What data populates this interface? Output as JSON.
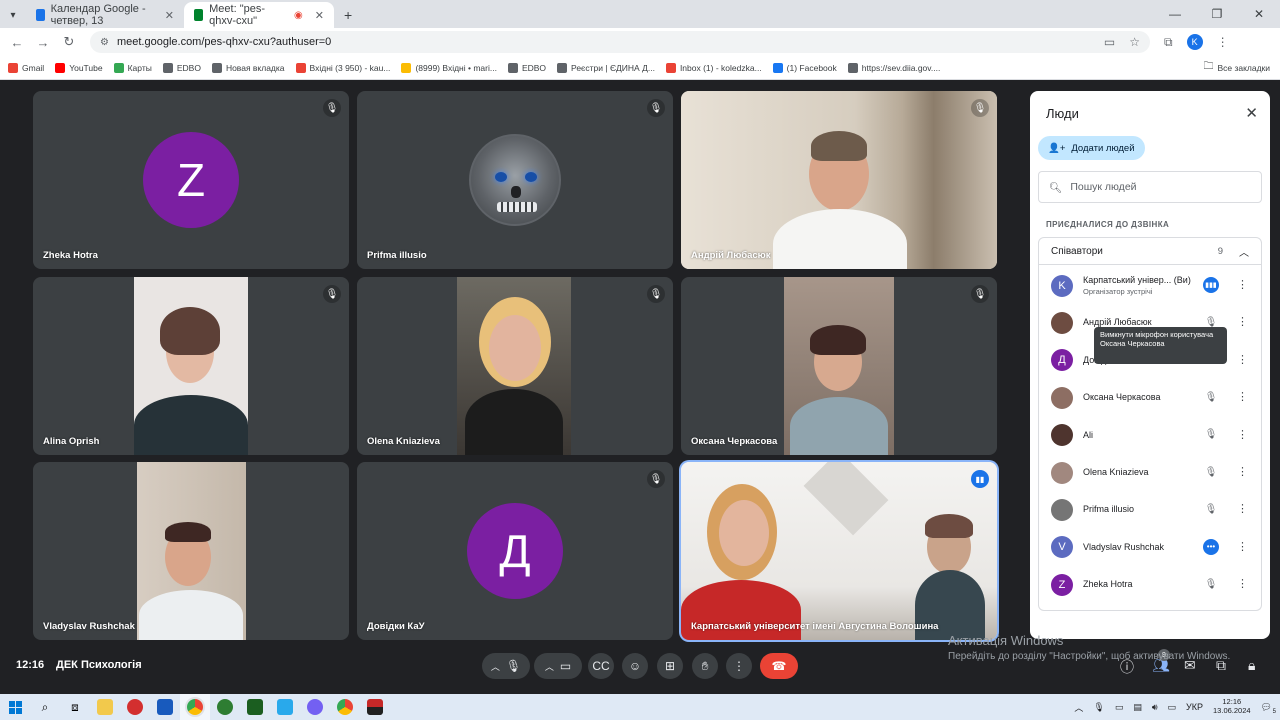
{
  "browser": {
    "tabs": [
      {
        "title": "Календар Google - четвер, 13",
        "favicon_color": "#1a73e8",
        "active": false
      },
      {
        "title": "Meet: \"pes-qhxv-cxu\"",
        "favicon_color": "#00832d",
        "active": true
      }
    ],
    "new_tab": "+",
    "url": "meet.google.com/pes-qhxv-cxu?authuser=0",
    "profile_initial": "K",
    "bookmarks": [
      {
        "label": "Gmail",
        "color": "#ea4335"
      },
      {
        "label": "YouTube",
        "color": "#ff0000"
      },
      {
        "label": "Карты",
        "color": "#34a853"
      },
      {
        "label": "EDBO",
        "color": "#5f6368"
      },
      {
        "label": "Новая вкладка",
        "color": "#5f6368"
      },
      {
        "label": "Вхідні (3 950) - kau...",
        "color": "#ea4335"
      },
      {
        "label": "(8999) Вхідні • mari...",
        "color": "#fbbc04"
      },
      {
        "label": "EDBO",
        "color": "#5f6368"
      },
      {
        "label": "Реєстри | ЄДИНА Д...",
        "color": "#5f6368"
      },
      {
        "label": "Inbox (1) - koledzka...",
        "color": "#ea4335"
      },
      {
        "label": "(1) Facebook",
        "color": "#1877f2"
      },
      {
        "label": "https://sev.diia.gov....",
        "color": "#5f6368"
      }
    ],
    "all_bookmarks": "Все закладки"
  },
  "tiles": [
    {
      "name": "Zheka Hotra",
      "type": "avatar",
      "initial": "Z",
      "color": "#7b1fa2",
      "muted": true
    },
    {
      "name": "Prifma illusio",
      "type": "skull",
      "muted": true
    },
    {
      "name": "Андрій Любасюк",
      "type": "video",
      "muted": true
    },
    {
      "name": "Alina Oprish",
      "type": "video",
      "muted": true
    },
    {
      "name": "Olena Kniazieva",
      "type": "video",
      "muted": true
    },
    {
      "name": "Оксана Черкасова",
      "type": "video",
      "muted": true
    },
    {
      "name": "Vladyslav Rushchak",
      "type": "video",
      "muted": false
    },
    {
      "name": "Довідки КаУ",
      "type": "avatar",
      "initial": "Д",
      "color": "#7b1fa2",
      "muted": true
    },
    {
      "name": "Карпатський університет імені Августина Волошина",
      "type": "video",
      "muted": false,
      "speaking": true
    }
  ],
  "bottom": {
    "time": "12:16",
    "meeting_title": "ДЕК Психологія",
    "people_count": "9",
    "watermark_title": "Активація Windows",
    "watermark_text": "Перейдіть до розділу \"Настройки\", щоб активувати Windows."
  },
  "panel": {
    "title": "Люди",
    "add_people": "Додати людей",
    "search_placeholder": "Пошук людей",
    "section_heading": "ПРИЄДНАЛИСЯ ДО ДЗВІНКА",
    "group_label": "Співавтори",
    "group_count": "9",
    "participants": [
      {
        "name": "Карпатський універ... (Ви)",
        "subtitle": "Організатор зустрічі",
        "avatar": "K",
        "avatar_color": "#5c6bc0",
        "status": "speaking"
      },
      {
        "name": "Андрій Любасюк",
        "avatar": "",
        "avatar_color": "#6d4c41",
        "status": "muted"
      },
      {
        "name": "Довідки КаУ",
        "avatar": "Д",
        "avatar_color": "#7b1fa2",
        "status": "muted"
      },
      {
        "name": "Оксана Черкасова",
        "avatar": "",
        "avatar_color": "#8d6e63",
        "status": "muted"
      },
      {
        "name": "Ali",
        "avatar": "",
        "avatar_color": "#4e342e",
        "status": "muted"
      },
      {
        "name": "Olena Kniazieva",
        "avatar": "",
        "avatar_color": "#a1887f",
        "status": "muted"
      },
      {
        "name": "Prifma illusio",
        "avatar": "",
        "avatar_color": "#757575",
        "status": "muted"
      },
      {
        "name": "Vladyslav Rushchak",
        "avatar": "V",
        "avatar_color": "#5c6bc0",
        "status": "unmuted"
      },
      {
        "name": "Zheka Hotra",
        "avatar": "Z",
        "avatar_color": "#7b1fa2",
        "status": "muted"
      }
    ],
    "tooltip": "Вимкнути мікрофон користувача Оксана Черкасова"
  },
  "taskbar": {
    "language": "УКР",
    "time": "12:16",
    "date": "13.06.2024",
    "notification_count": "5"
  }
}
